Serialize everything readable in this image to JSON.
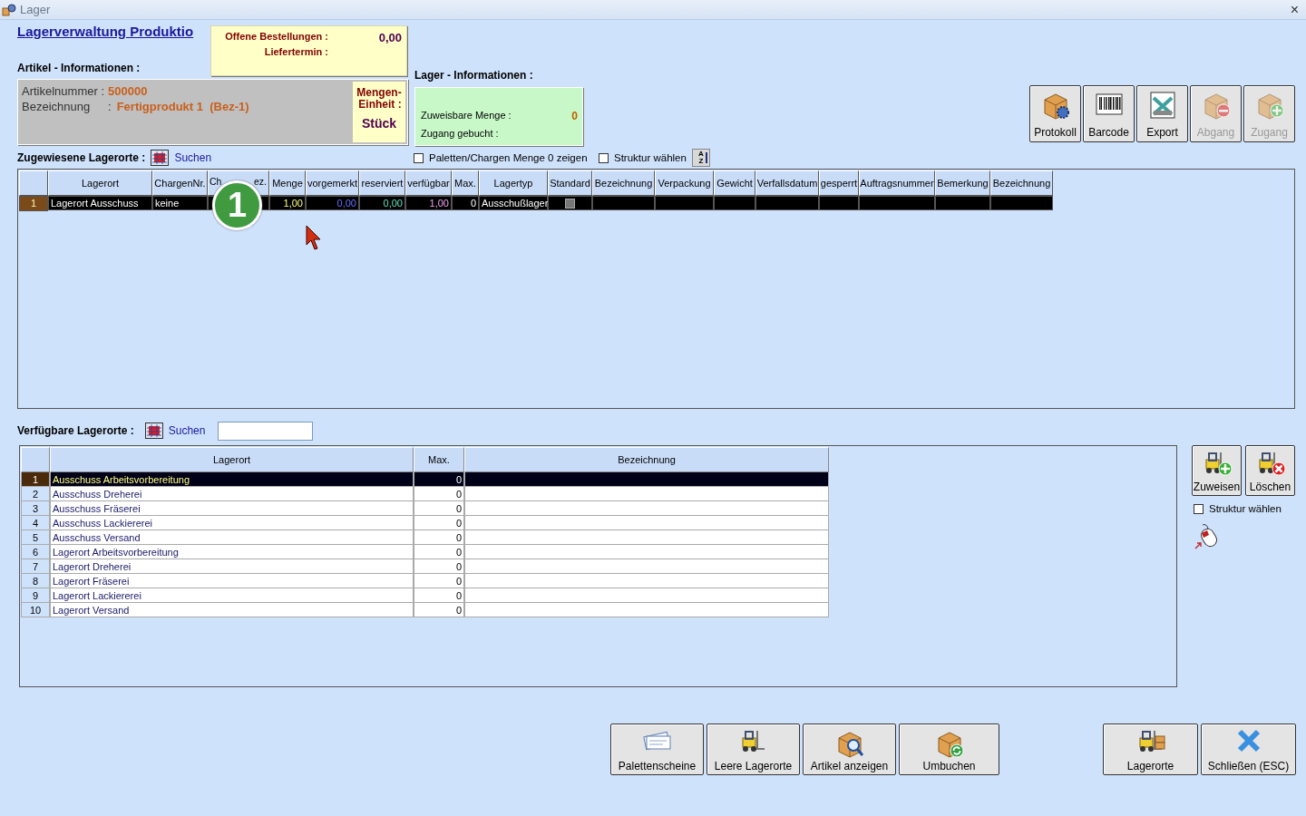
{
  "window": {
    "title": "Lager",
    "close": "×"
  },
  "heading": "Lagerverwaltung Produktio",
  "orders": {
    "open_label": "Offene Bestellungen :",
    "open_value": "0,00",
    "delivery_label": "Liefertermin :"
  },
  "article": {
    "section": "Artikel - Informationen :",
    "number_label": "Artikelnummer :",
    "number": "500000",
    "name_label": "Bezeichnung",
    "name_sep": ":",
    "name": "Fertigprodukt 1  (Bez-1)",
    "unit_label": "Mengen-\nEinheit :",
    "unit": "Stück"
  },
  "storage": {
    "section": "Lager - Informationen :",
    "assignable_label": "Zuweisbare Menge :",
    "assignable_value": "0",
    "posted_label": "Zugang gebucht :"
  },
  "toolbar": [
    {
      "label": "Protokoll",
      "kind": "box-gear",
      "disabled": false
    },
    {
      "label": "Barcode",
      "kind": "barcode",
      "disabled": false
    },
    {
      "label": "Export",
      "kind": "export",
      "disabled": false
    },
    {
      "label": "Abgang",
      "kind": "box-minus",
      "disabled": true
    },
    {
      "label": "Zugang",
      "kind": "box-plus",
      "disabled": true
    }
  ],
  "assigned": {
    "title": "Zugewiesene Lagerorte :",
    "search": "Suchen",
    "show_zero": {
      "label": "Paletten/Chargen Menge 0 zeigen",
      "checked": false
    },
    "structure": {
      "label": "Struktur wählen",
      "checked": false
    },
    "sort": {
      "top": "A",
      "bottom": "Z"
    },
    "columns": [
      {
        "label": "Lagerort"
      },
      {
        "label": "ChargenNr."
      },
      {
        "label": "Ch",
        "label_end": "ez."
      },
      {
        "label": "Menge"
      },
      {
        "label": "vorgemerkt"
      },
      {
        "label": "reserviert"
      },
      {
        "label": "verfügbar"
      },
      {
        "label": "Max."
      },
      {
        "label": "Lagertyp"
      },
      {
        "label": "Standard"
      },
      {
        "label": "Bezeichnung"
      },
      {
        "label": "Verpackung"
      },
      {
        "label": "Gewicht"
      },
      {
        "label": "Verfallsdatum"
      },
      {
        "label": "gesperrt"
      },
      {
        "label": "Auftragsnummer"
      },
      {
        "label": "Bemerkung"
      },
      {
        "label": "Bezeichnung"
      }
    ],
    "rows": [
      {
        "number": "1",
        "selected": true,
        "lagerort": "Lagerort Ausschuss",
        "chargen_nr": "keine",
        "menge": "1,00",
        "vorgemerkt": "0,00",
        "reserviert": "0,00",
        "verfuegbar": "1,00",
        "max": "0",
        "lagertyp": "Ausschußlager",
        "standard": false
      }
    ]
  },
  "badge": {
    "text": "1"
  },
  "available": {
    "title": "Verfügbare Lagerorte :",
    "search": "Suchen",
    "columns": [
      "Lagerort",
      "Max.",
      "Bezeichnung"
    ],
    "rows": [
      {
        "number": "1",
        "name": "Ausschuss Arbeitsvorbereitung",
        "max": "0",
        "selected": true
      },
      {
        "number": "2",
        "name": "Ausschuss Dreherei",
        "max": "0",
        "selected": false
      },
      {
        "number": "3",
        "name": "Ausschuss Fräserei",
        "max": "0",
        "selected": false
      },
      {
        "number": "4",
        "name": "Ausschuss Lackiererei",
        "max": "0",
        "selected": false
      },
      {
        "number": "5",
        "name": "Ausschuss Versand",
        "max": "0",
        "selected": false
      },
      {
        "number": "6",
        "name": "Lagerort Arbeitsvorbereitung",
        "max": "0",
        "selected": false
      },
      {
        "number": "7",
        "name": "Lagerort Dreherei",
        "max": "0",
        "selected": false
      },
      {
        "number": "8",
        "name": "Lagerort Fräserei",
        "max": "0",
        "selected": false
      },
      {
        "number": "9",
        "name": "Lagerort Lackiererei",
        "max": "0",
        "selected": false
      },
      {
        "number": "10",
        "name": "Lagerort Versand",
        "max": "0",
        "selected": false
      }
    ]
  },
  "side": {
    "buttons": [
      {
        "label": "Zuweisen",
        "kind": "forklift-plus"
      },
      {
        "label": "Löschen",
        "kind": "forklift-cross"
      }
    ],
    "structure": {
      "label": "Struktur wählen",
      "checked": false
    }
  },
  "bottom_buttons": [
    {
      "label": "Palettenscheine",
      "kind": "tickets"
    },
    {
      "label": "Leere Lagerorte",
      "kind": "forklift"
    },
    {
      "label": "Artikel anzeigen",
      "kind": "box-search"
    },
    {
      "label": "Umbuchen",
      "kind": "box-refresh"
    }
  ],
  "right_buttons": [
    {
      "label": "Lagerorte",
      "kind": "forklift-boxes"
    },
    {
      "label": "Schließen (ESC)",
      "kind": "close"
    }
  ]
}
